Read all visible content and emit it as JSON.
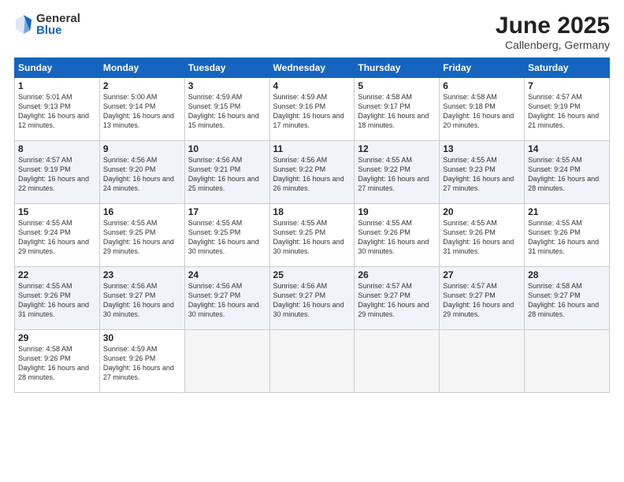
{
  "logo": {
    "general": "General",
    "blue": "Blue"
  },
  "title": {
    "month": "June 2025",
    "location": "Callenberg, Germany"
  },
  "headers": [
    "Sunday",
    "Monday",
    "Tuesday",
    "Wednesday",
    "Thursday",
    "Friday",
    "Saturday"
  ],
  "weeks": [
    [
      {
        "day": "1",
        "sunrise": "Sunrise: 5:01 AM",
        "sunset": "Sunset: 9:13 PM",
        "daylight": "Daylight: 16 hours and 12 minutes."
      },
      {
        "day": "2",
        "sunrise": "Sunrise: 5:00 AM",
        "sunset": "Sunset: 9:14 PM",
        "daylight": "Daylight: 16 hours and 13 minutes."
      },
      {
        "day": "3",
        "sunrise": "Sunrise: 4:59 AM",
        "sunset": "Sunset: 9:15 PM",
        "daylight": "Daylight: 16 hours and 15 minutes."
      },
      {
        "day": "4",
        "sunrise": "Sunrise: 4:59 AM",
        "sunset": "Sunset: 9:16 PM",
        "daylight": "Daylight: 16 hours and 17 minutes."
      },
      {
        "day": "5",
        "sunrise": "Sunrise: 4:58 AM",
        "sunset": "Sunset: 9:17 PM",
        "daylight": "Daylight: 16 hours and 18 minutes."
      },
      {
        "day": "6",
        "sunrise": "Sunrise: 4:58 AM",
        "sunset": "Sunset: 9:18 PM",
        "daylight": "Daylight: 16 hours and 20 minutes."
      },
      {
        "day": "7",
        "sunrise": "Sunrise: 4:57 AM",
        "sunset": "Sunset: 9:19 PM",
        "daylight": "Daylight: 16 hours and 21 minutes."
      }
    ],
    [
      {
        "day": "8",
        "sunrise": "Sunrise: 4:57 AM",
        "sunset": "Sunset: 9:19 PM",
        "daylight": "Daylight: 16 hours and 22 minutes."
      },
      {
        "day": "9",
        "sunrise": "Sunrise: 4:56 AM",
        "sunset": "Sunset: 9:20 PM",
        "daylight": "Daylight: 16 hours and 24 minutes."
      },
      {
        "day": "10",
        "sunrise": "Sunrise: 4:56 AM",
        "sunset": "Sunset: 9:21 PM",
        "daylight": "Daylight: 16 hours and 25 minutes."
      },
      {
        "day": "11",
        "sunrise": "Sunrise: 4:56 AM",
        "sunset": "Sunset: 9:22 PM",
        "daylight": "Daylight: 16 hours and 26 minutes."
      },
      {
        "day": "12",
        "sunrise": "Sunrise: 4:55 AM",
        "sunset": "Sunset: 9:22 PM",
        "daylight": "Daylight: 16 hours and 27 minutes."
      },
      {
        "day": "13",
        "sunrise": "Sunrise: 4:55 AM",
        "sunset": "Sunset: 9:23 PM",
        "daylight": "Daylight: 16 hours and 27 minutes."
      },
      {
        "day": "14",
        "sunrise": "Sunrise: 4:55 AM",
        "sunset": "Sunset: 9:24 PM",
        "daylight": "Daylight: 16 hours and 28 minutes."
      }
    ],
    [
      {
        "day": "15",
        "sunrise": "Sunrise: 4:55 AM",
        "sunset": "Sunset: 9:24 PM",
        "daylight": "Daylight: 16 hours and 29 minutes."
      },
      {
        "day": "16",
        "sunrise": "Sunrise: 4:55 AM",
        "sunset": "Sunset: 9:25 PM",
        "daylight": "Daylight: 16 hours and 29 minutes."
      },
      {
        "day": "17",
        "sunrise": "Sunrise: 4:55 AM",
        "sunset": "Sunset: 9:25 PM",
        "daylight": "Daylight: 16 hours and 30 minutes."
      },
      {
        "day": "18",
        "sunrise": "Sunrise: 4:55 AM",
        "sunset": "Sunset: 9:25 PM",
        "daylight": "Daylight: 16 hours and 30 minutes."
      },
      {
        "day": "19",
        "sunrise": "Sunrise: 4:55 AM",
        "sunset": "Sunset: 9:26 PM",
        "daylight": "Daylight: 16 hours and 30 minutes."
      },
      {
        "day": "20",
        "sunrise": "Sunrise: 4:55 AM",
        "sunset": "Sunset: 9:26 PM",
        "daylight": "Daylight: 16 hours and 31 minutes."
      },
      {
        "day": "21",
        "sunrise": "Sunrise: 4:55 AM",
        "sunset": "Sunset: 9:26 PM",
        "daylight": "Daylight: 16 hours and 31 minutes."
      }
    ],
    [
      {
        "day": "22",
        "sunrise": "Sunrise: 4:55 AM",
        "sunset": "Sunset: 9:26 PM",
        "daylight": "Daylight: 16 hours and 31 minutes."
      },
      {
        "day": "23",
        "sunrise": "Sunrise: 4:56 AM",
        "sunset": "Sunset: 9:27 PM",
        "daylight": "Daylight: 16 hours and 30 minutes."
      },
      {
        "day": "24",
        "sunrise": "Sunrise: 4:56 AM",
        "sunset": "Sunset: 9:27 PM",
        "daylight": "Daylight: 16 hours and 30 minutes."
      },
      {
        "day": "25",
        "sunrise": "Sunrise: 4:56 AM",
        "sunset": "Sunset: 9:27 PM",
        "daylight": "Daylight: 16 hours and 30 minutes."
      },
      {
        "day": "26",
        "sunrise": "Sunrise: 4:57 AM",
        "sunset": "Sunset: 9:27 PM",
        "daylight": "Daylight: 16 hours and 29 minutes."
      },
      {
        "day": "27",
        "sunrise": "Sunrise: 4:57 AM",
        "sunset": "Sunset: 9:27 PM",
        "daylight": "Daylight: 16 hours and 29 minutes."
      },
      {
        "day": "28",
        "sunrise": "Sunrise: 4:58 AM",
        "sunset": "Sunset: 9:27 PM",
        "daylight": "Daylight: 16 hours and 28 minutes."
      }
    ],
    [
      {
        "day": "29",
        "sunrise": "Sunrise: 4:58 AM",
        "sunset": "Sunset: 9:26 PM",
        "daylight": "Daylight: 16 hours and 28 minutes."
      },
      {
        "day": "30",
        "sunrise": "Sunrise: 4:59 AM",
        "sunset": "Sunset: 9:26 PM",
        "daylight": "Daylight: 16 hours and 27 minutes."
      },
      null,
      null,
      null,
      null,
      null
    ]
  ]
}
